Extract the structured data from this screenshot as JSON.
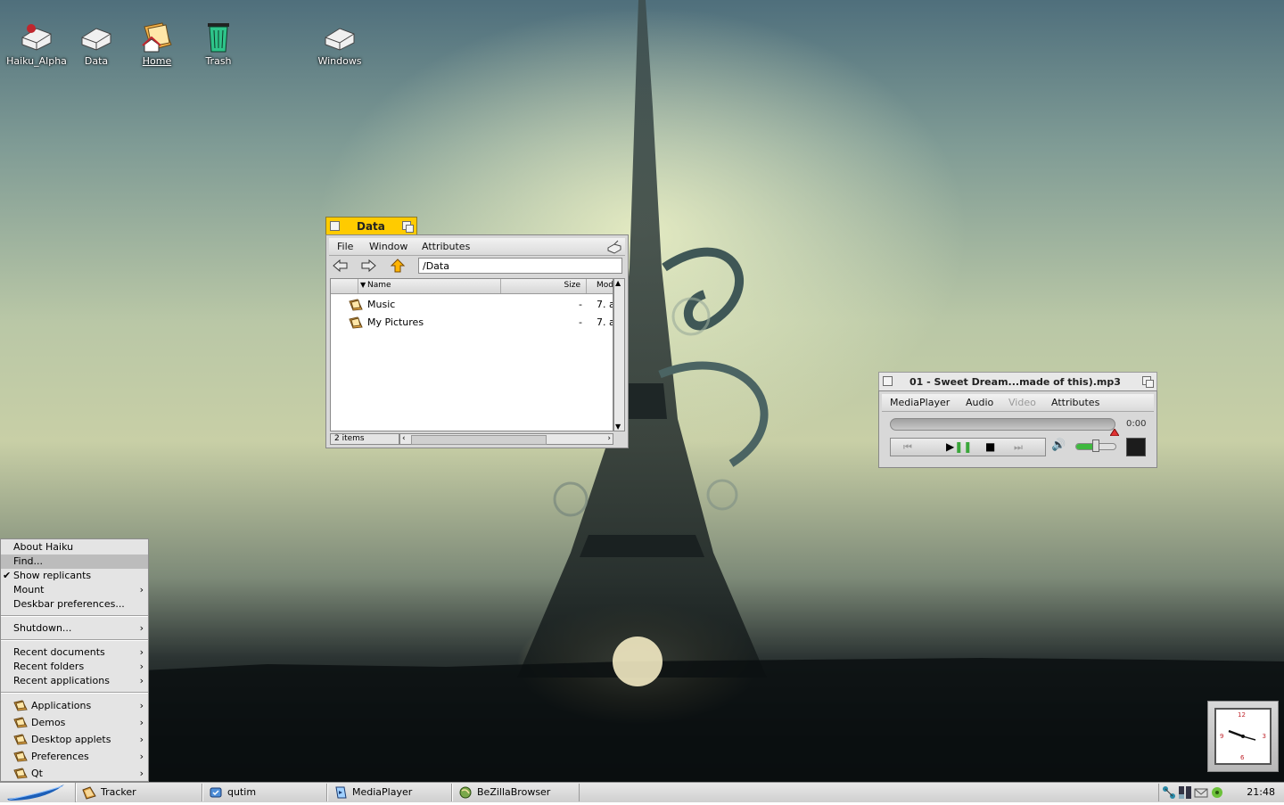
{
  "desktop_icons": [
    {
      "label": "Haiku_Alpha",
      "icon": "drive-icon"
    },
    {
      "label": "Data",
      "icon": "drive-icon"
    },
    {
      "label": "Home",
      "icon": "home-folder-icon"
    },
    {
      "label": "Trash",
      "icon": "trash-icon"
    },
    {
      "label": "Windows",
      "icon": "drive-icon"
    }
  ],
  "tracker_window": {
    "title": "Data",
    "menu": [
      "File",
      "Window",
      "Attributes"
    ],
    "path": "/Data",
    "columns": {
      "name": "Name",
      "size": "Size",
      "modified": "Mod"
    },
    "rows": [
      {
        "name": "Music",
        "size": "-",
        "modified": "7. a"
      },
      {
        "name": "My Pictures",
        "size": "-",
        "modified": "7. a"
      }
    ],
    "status": "2 items"
  },
  "media_player": {
    "title": "01 - Sweet Dream...made of this).mp3",
    "menu": [
      "MediaPlayer",
      "Audio",
      "Video",
      "Attributes"
    ],
    "time": "0:00",
    "progress": 0.0,
    "volume": 0.5
  },
  "deskbar_menu": {
    "items": [
      {
        "label": "About Haiku"
      },
      {
        "label": "Find..."
      },
      {
        "label": "Show replicants",
        "checked": true
      },
      {
        "label": "Mount"
      },
      {
        "label": "Deskbar preferences..."
      },
      {
        "label": "Shutdown..."
      },
      {
        "label": "Recent documents"
      },
      {
        "label": "Recent folders"
      },
      {
        "label": "Recent applications"
      },
      {
        "label": "Applications"
      },
      {
        "label": "Demos"
      },
      {
        "label": "Desktop applets"
      },
      {
        "label": "Preferences"
      },
      {
        "label": "Qt"
      }
    ],
    "check_mark": "✔",
    "submenu_arrow": "›"
  },
  "taskbar": {
    "apps": [
      {
        "label": "Tracker",
        "icon": "tracker-icon"
      },
      {
        "label": "qutim",
        "icon": "qutim-icon"
      },
      {
        "label": "MediaPlayer",
        "icon": "mediaplayer-icon"
      },
      {
        "label": "BeZillaBrowser",
        "icon": "browser-icon"
      }
    ],
    "clock": "21:48"
  },
  "clock_replicant": {
    "numerals": [
      "12",
      "3",
      "6",
      "9"
    ]
  },
  "colors": {
    "window_tab_active": "#ffcb00",
    "menu_bg": "#e4e4e4",
    "highlight": "#bcbcbc"
  }
}
